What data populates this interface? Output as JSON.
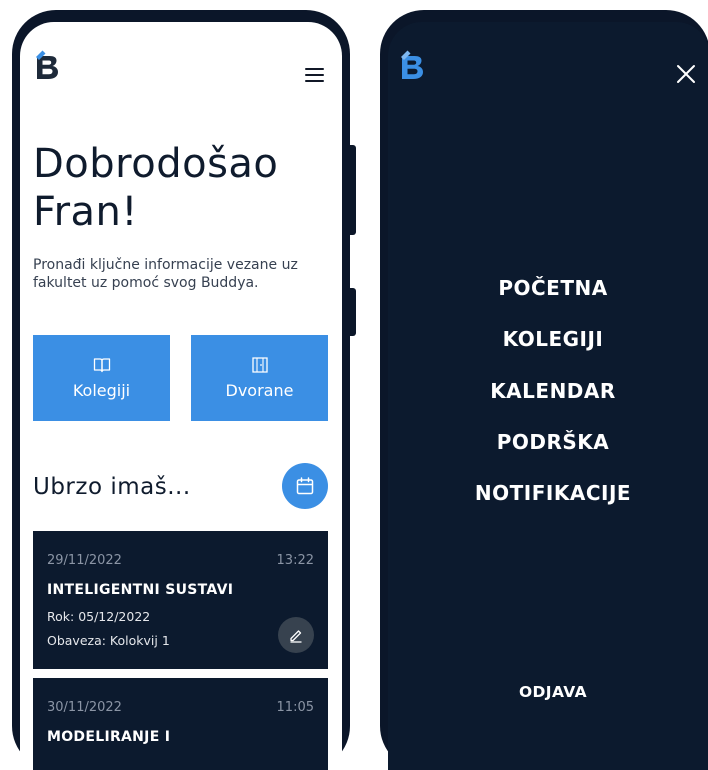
{
  "home": {
    "greeting_line1": "Dobrodošao",
    "greeting_line2": "Fran!",
    "subtitle": "Pronađi ključne informacije vezane uz fakultet uz pomoć svog Buddya.",
    "tiles": [
      {
        "label": "Kolegiji",
        "icon": "book-icon"
      },
      {
        "label": "Dvorane",
        "icon": "door-icon"
      }
    ],
    "upcoming_title": "Ubrzo imaš...",
    "tasks": [
      {
        "date": "29/11/2022",
        "time": "13:22",
        "course": "INTELIGENTNI SUSTAVI",
        "deadline": "Rok: 05/12/2022",
        "obligation": "Obaveza: Kolokvij 1"
      },
      {
        "date": "30/11/2022",
        "time": "11:05",
        "course": "MODELIRANJE I"
      }
    ]
  },
  "menu": {
    "items": [
      "POČETNA",
      "KOLEGIJI",
      "KALENDAR",
      "PODRŠKA",
      "NOTIFIKACIJE"
    ],
    "logout": "ODJAVA"
  },
  "colors": {
    "accent": "#3b8fe4",
    "navy": "#0c1a2e",
    "logo_dark": "#1e2a3a"
  }
}
